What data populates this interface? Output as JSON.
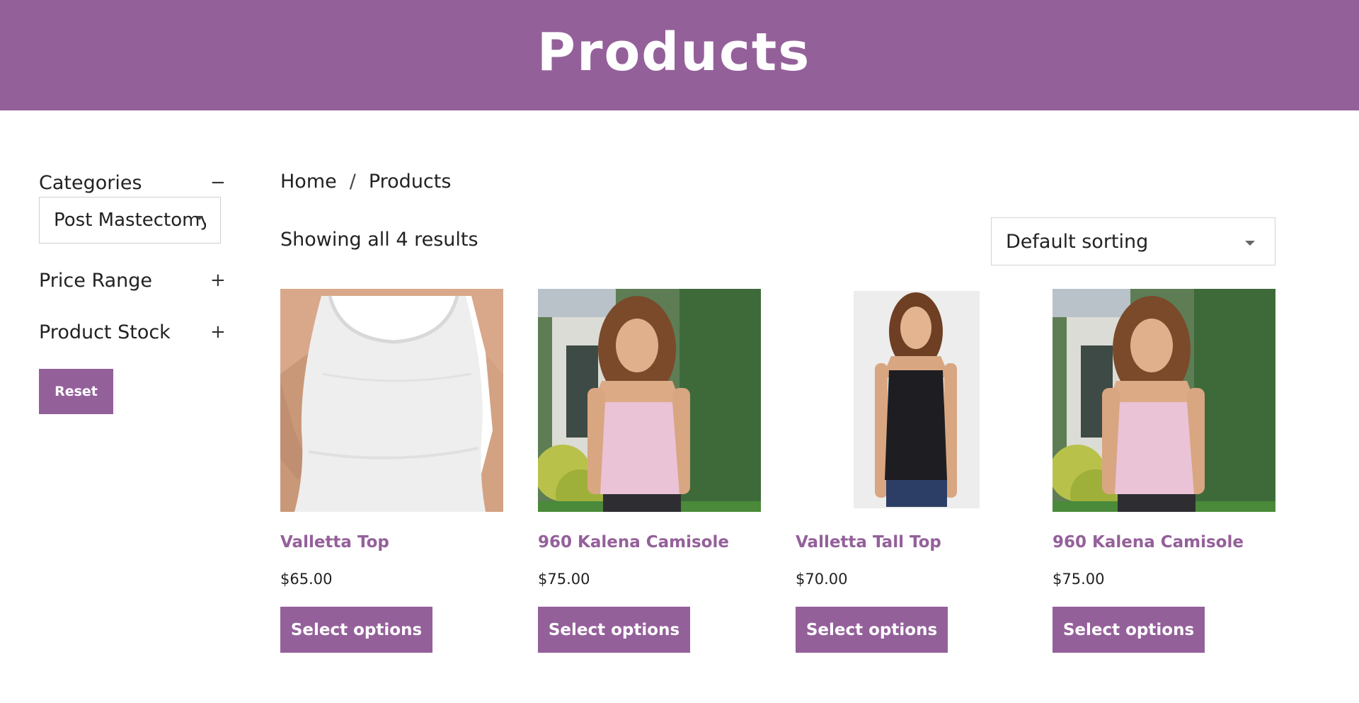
{
  "header": {
    "title": "Products"
  },
  "sidebar": {
    "categories": {
      "label": "Categories",
      "toggle": "−",
      "selected": "Post Mastectomy"
    },
    "price_range": {
      "label": "Price Range",
      "toggle": "+"
    },
    "product_stock": {
      "label": "Product Stock",
      "toggle": "+"
    },
    "reset_label": "Reset"
  },
  "breadcrumb": {
    "home": "Home",
    "separator": "/",
    "current": "Products"
  },
  "results_text": "Showing all 4 results",
  "sort": {
    "selected": "Default sorting"
  },
  "products": [
    {
      "title": "Valletta Top",
      "price": "$65.00",
      "button": "Select options",
      "image": "white-tank-top"
    },
    {
      "title": "960 Kalena Camisole",
      "price": "$75.00",
      "button": "Select options",
      "image": "pink-camisole-outdoor"
    },
    {
      "title": "Valletta Tall Top",
      "price": "$70.00",
      "button": "Select options",
      "image": "black-tank-studio"
    },
    {
      "title": "960 Kalena Camisole",
      "price": "$75.00",
      "button": "Select options",
      "image": "pink-camisole-outdoor"
    }
  ],
  "colors": {
    "brand": "#94609a",
    "text": "#222222",
    "border": "#d4d4d4"
  }
}
